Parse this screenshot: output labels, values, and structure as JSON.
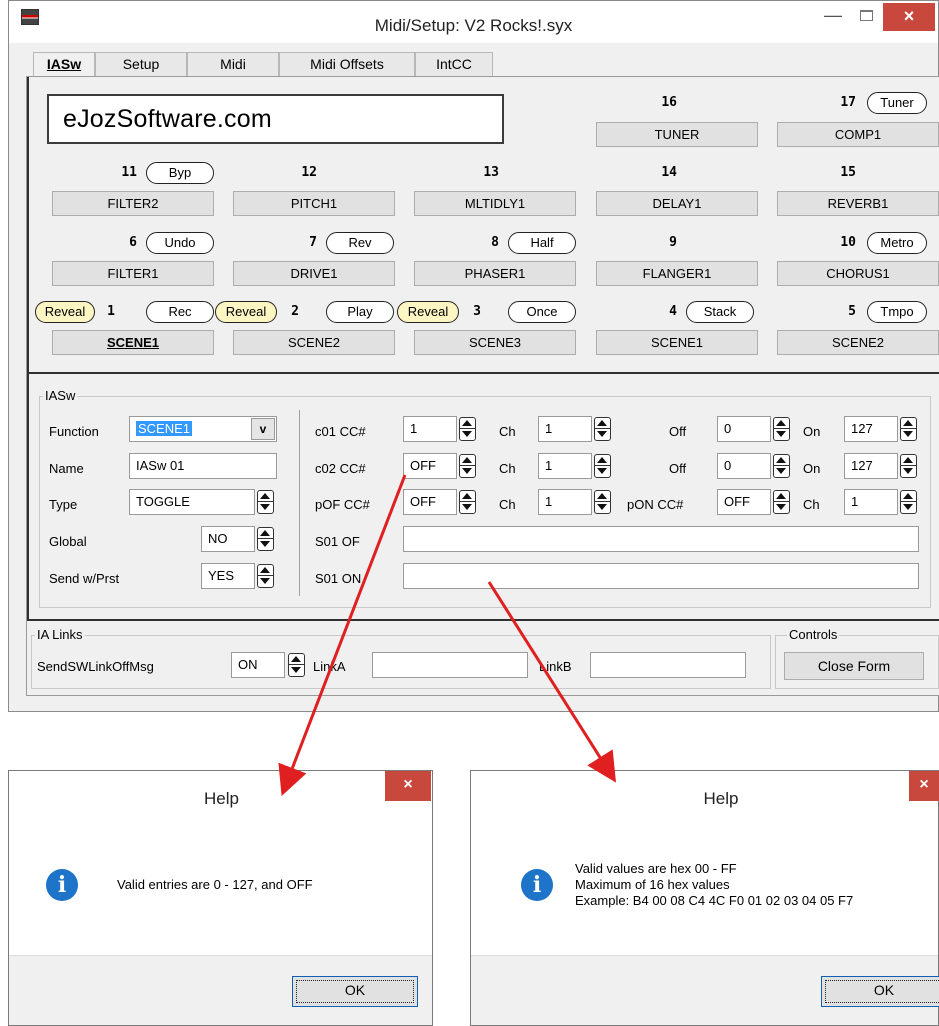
{
  "window": {
    "title": "Midi/Setup: V2 Rocks!.syx",
    "minimize": "—",
    "close": "×"
  },
  "tabs": [
    "IASw",
    "Setup",
    "Midi",
    "Midi Offsets",
    "IntCC"
  ],
  "logo": "eJozSoftware.com",
  "switches": {
    "top": [
      {
        "num": "16",
        "button": "TUNER"
      },
      {
        "num": "17",
        "pill": "Tuner",
        "button": "COMP1"
      }
    ],
    "row2": [
      {
        "num": "11",
        "pill": "Byp",
        "button": "FILTER2"
      },
      {
        "num": "12",
        "button": "PITCH1"
      },
      {
        "num": "13",
        "button": "MLTIDLY1"
      },
      {
        "num": "14",
        "button": "DELAY1"
      },
      {
        "num": "15",
        "button": "REVERB1"
      }
    ],
    "row3": [
      {
        "num": "6",
        "pill": "Undo",
        "button": "FILTER1"
      },
      {
        "num": "7",
        "pill": "Rev",
        "button": "DRIVE1"
      },
      {
        "num": "8",
        "pill": "Half",
        "button": "PHASER1"
      },
      {
        "num": "9",
        "button": "FLANGER1"
      },
      {
        "num": "10",
        "pill": "Metro",
        "button": "CHORUS1"
      }
    ],
    "row4": [
      {
        "num": "1",
        "reveal": "Reveal",
        "pill": "Rec",
        "button": "SCENE1"
      },
      {
        "num": "2",
        "reveal": "Reveal",
        "pill": "Play",
        "button": "SCENE2"
      },
      {
        "num": "3",
        "reveal": "Reveal",
        "pill": "Once",
        "button": "SCENE3"
      },
      {
        "num": "4",
        "pill": "Stack",
        "button": "SCENE1"
      },
      {
        "num": "5",
        "pill": "Tmpo",
        "button": "SCENE2"
      }
    ]
  },
  "iasw": {
    "group_label": "IASw",
    "function_label": "Function",
    "function_value": "SCENE1",
    "dropdown_glyph": "v",
    "name_label": "Name",
    "name_value": "IASw 01",
    "type_label": "Type",
    "type_value": "TOGGLE",
    "global_label": "Global",
    "global_value": "NO",
    "sendwprst_label": "Send w/Prst",
    "sendwprst_value": "YES",
    "c01_label": "c01 CC#",
    "c01_value": "1",
    "c01_ch_label": "Ch",
    "c01_ch": "1",
    "c01_off_label": "Off",
    "c01_off": "0",
    "c01_on_label": "On",
    "c01_on": "127",
    "c02_label": "c02 CC#",
    "c02_value": "OFF",
    "c02_ch_label": "Ch",
    "c02_ch": "1",
    "c02_off_label": "Off",
    "c02_off": "0",
    "c02_on_label": "On",
    "c02_on": "127",
    "pof_label": "pOF CC#",
    "pof_value": "OFF",
    "pof_ch_label": "Ch",
    "pof_ch": "1",
    "pon_label": "pON CC#",
    "pon_value": "OFF",
    "pon_ch_label": "Ch",
    "pon_ch": "1",
    "s01of_label": "S01 OF",
    "s01of_value": "",
    "s01on_label": "S01 ON",
    "s01on_value": ""
  },
  "ialinks": {
    "group_label": "IA Links",
    "sendsw_label": "SendSWLinkOffMsg",
    "sendsw_value": "ON",
    "linka_label": "LinkA",
    "linka_value": "",
    "linkb_label": "LinkB",
    "linkb_value": ""
  },
  "controls": {
    "group_label": "Controls",
    "close_form": "Close Form"
  },
  "help1": {
    "title": "Help",
    "close": "×",
    "icon": "i",
    "message": "Valid entries are 0 - 127, and OFF",
    "ok": "OK"
  },
  "help2": {
    "title": "Help",
    "close": "×",
    "icon": "i",
    "line1": "Valid values are hex 00 - FF",
    "line2": "Maximum of 16 hex values",
    "line3": "Example: B4 00 08 C4 4C F0 01 02 03 04 05 F7",
    "ok": "OK"
  },
  "colors": {
    "arrow": "#e02020",
    "close_red": "#c9483e",
    "reveal_yellow": "#fdf6c3",
    "info_blue": "#1e74c8"
  }
}
